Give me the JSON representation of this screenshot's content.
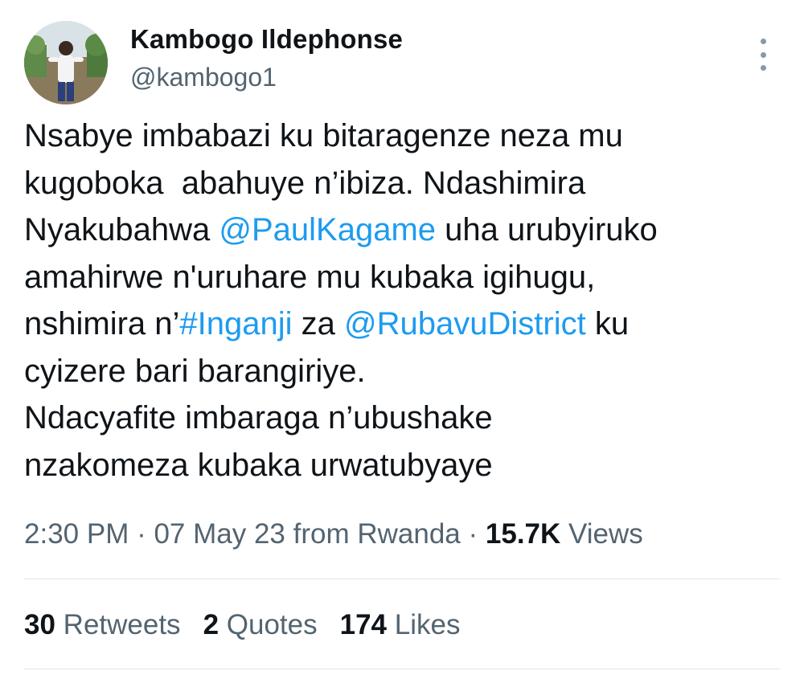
{
  "author": {
    "name": "Kambogo Ildephonse",
    "handle": "@kambogo1"
  },
  "tweet": {
    "t1": "Nsabye imbabazi ku bitaragenze neza mu\nkugoboka  abahuye n’ibiza. Ndashimira\nNyakubahwa ",
    "mention1": "@PaulKagame",
    "t2": " uha urubyiruko\namahirwe n'uruhare mu kubaka igihugu,\nnshimira n’",
    "hashtag": "#Inganji",
    "t3": " za ",
    "mention2": "@RubavuDistrict",
    "t4": " ku\ncyizere bari barangiriye.\nNdacyafite imbaraga n’ubushake\nnzakomeza kubaka urwatubyaye"
  },
  "meta": {
    "time": "2:30 PM",
    "sep1": " · ",
    "date": "07 May 23",
    "location": " from Rwanda",
    "sep2": " · ",
    "views_count": "15.7K",
    "views_label": " Views"
  },
  "stats": {
    "retweets_count": "30",
    "retweets_label": " Retweets",
    "quotes_count": "2",
    "quotes_label": " Quotes",
    "likes_count": "174",
    "likes_label": " Likes"
  },
  "icons": {
    "more": "more-vertical-icon"
  },
  "colors": {
    "link": "#1d9bf0",
    "secondary_text": "#536471",
    "primary_text": "#0f1419"
  }
}
